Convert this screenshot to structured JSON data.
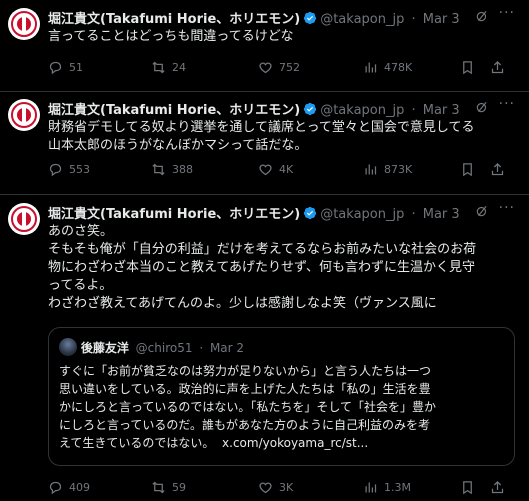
{
  "author": {
    "name": "堀江貴文(Takafumi Horie、ホリエモン)",
    "handle": "@takapon_jp"
  },
  "tweets": [
    {
      "date": "Mar 3",
      "text": "言ってることはどっちも間違ってるけどな",
      "stats": {
        "replies": "51",
        "retweets": "24",
        "likes": "752",
        "views": "478K"
      }
    },
    {
      "date": "Mar 3",
      "text": "財務省デモしてる奴より選挙を通して議席とって堂々と国会で意見してる\n山本太郎のほうがなんぼかマシって話だな。",
      "stats": {
        "replies": "553",
        "retweets": "388",
        "likes": "4K",
        "views": "873K"
      }
    },
    {
      "date": "Mar 3",
      "text": "あのさ笑。\nそもそも俺が「自分の利益」だけを考えてるならお前みたいな社会のお荷\n物にわざわざ本当のこと教えてあげたりせず、何も言わずに生温かく見守\nってるよ。\nわざわざ教えてあげてんのよ。少しは感謝しなよ笑（ヴァンス風に",
      "stats": {
        "replies": "409",
        "retweets": "59",
        "likes": "3K",
        "views": "1.3M"
      },
      "quote": {
        "name": "後藤友洋",
        "handle": "@chiro51",
        "date": "Mar 2",
        "text": "すぐに「お前が貧乏なのは努力が足りないから」と言う人たちは一つ\n思い違いをしている。政治的に声を上げた人たちは「私の」生活を豊\nかにしろと言っているのではない。「私たちを」そして「社会を」豊か\nにしろと言っているのだ。誰もがあなた方のように自己利益のみを考\nえて生きているのではない。",
        "link": "x.com/yokoyama_rc/st..."
      }
    }
  ],
  "colors": {
    "background": "#000000",
    "text": "#e7e9ea",
    "muted": "#71767b",
    "verified": "#1d9bf0",
    "border": "#2f3336"
  }
}
